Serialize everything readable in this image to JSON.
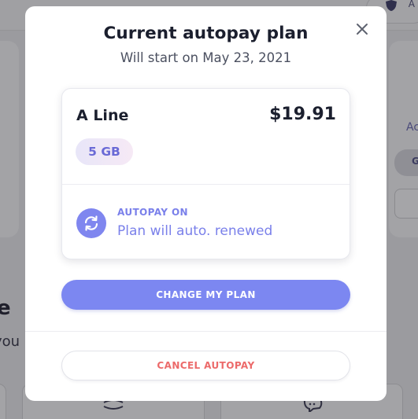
{
  "background": {
    "corner_letter": "A",
    "right_snippet": "Ac",
    "right_pill_letter": "G",
    "heading_fragment": "e",
    "subheading_fragment": "you"
  },
  "modal": {
    "title": "Current autopay plan",
    "subtitle": "Will start on May 23, 2021",
    "close_icon": "close-icon"
  },
  "plan": {
    "name": "A Line",
    "price": "$19.91",
    "data_badge": "5 GB"
  },
  "autopay": {
    "icon": "refresh-icon",
    "status": "AUTOPAY ON",
    "description": "Plan will auto. renewed"
  },
  "actions": {
    "change_plan": "CHANGE MY PLAN",
    "cancel_autopay": "CANCEL AUTOPAY"
  },
  "colors": {
    "accent": "#7c87f1",
    "danger": "#ec6a6a",
    "title": "#1b1f2e",
    "overlay": "#9b9b9f"
  }
}
